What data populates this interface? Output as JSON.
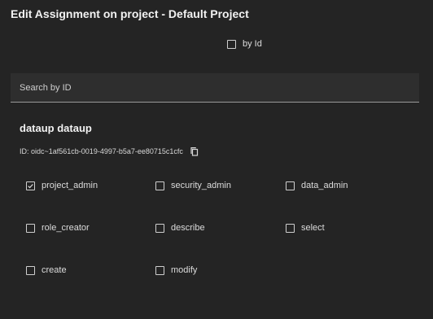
{
  "dialog": {
    "title": "Edit Assignment on project - Default Project",
    "by_id_label": "by Id",
    "by_id_checked": false,
    "search_placeholder": "Search by ID"
  },
  "user": {
    "name": "dataup dataup",
    "id_text": "ID: oidc~1af561cb-0019-4997-b5a7-ee80715c1cfc"
  },
  "roles": [
    {
      "label": "project_admin",
      "checked": true
    },
    {
      "label": "security_admin",
      "checked": false
    },
    {
      "label": "data_admin",
      "checked": false
    },
    {
      "label": "role_creator",
      "checked": false
    },
    {
      "label": "describe",
      "checked": false
    },
    {
      "label": "select",
      "checked": false
    },
    {
      "label": "create",
      "checked": false
    },
    {
      "label": "modify",
      "checked": false
    }
  ],
  "icons": {
    "checkbox": "checkbox-icon",
    "copy": "copy-icon"
  }
}
